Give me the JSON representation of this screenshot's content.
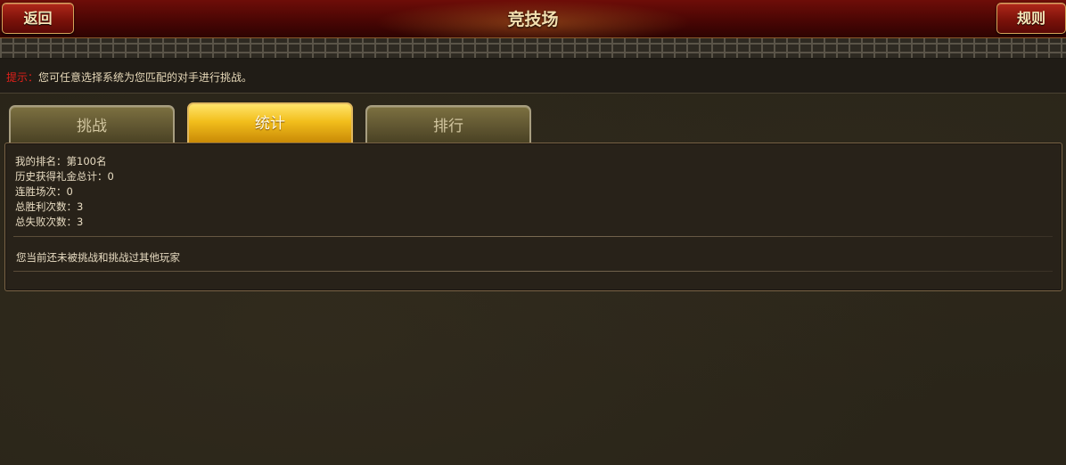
{
  "header": {
    "title": "竞技场",
    "back_label": "返回",
    "rules_label": "规则"
  },
  "hint": {
    "label": "提示：",
    "text": "您可任意选择系统为您匹配的对手进行挑战。"
  },
  "tabs": [
    {
      "label": "挑战",
      "active": false
    },
    {
      "label": "统计",
      "active": true
    },
    {
      "label": "排行",
      "active": false
    }
  ],
  "stats": {
    "rank": "我的排名：第100名",
    "total_gift": "历史获得礼金总计：0",
    "streak": "连胜场次：0",
    "wins": "总胜利次数：3",
    "losses": "总失败次数：3"
  },
  "message": "您当前还未被挑战和挑战过其他玩家",
  "colors": {
    "header_red": "#6e0d08",
    "tab_active_gold": "#f2be1c",
    "tab_inactive_olive": "#5e5430",
    "hint_red": "#e0201a",
    "background": "#2a2519"
  }
}
